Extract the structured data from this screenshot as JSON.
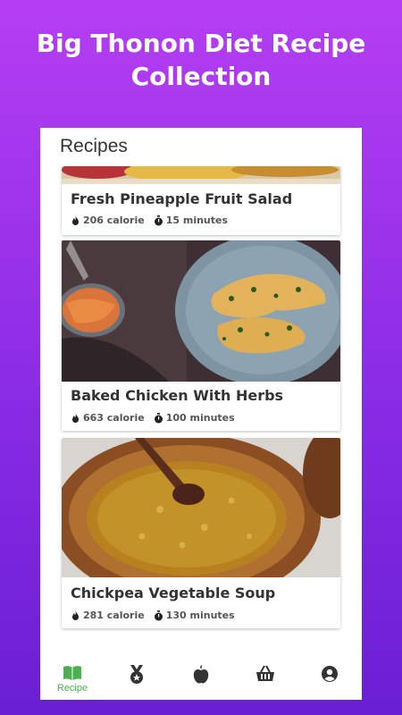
{
  "promo": {
    "headline_line1": "Big Thonon Diet Recipe",
    "headline_line2": "Collection"
  },
  "screen": {
    "section_title": "Recipes"
  },
  "recipes": [
    {
      "title": "Fresh Pineapple Fruit Salad",
      "calories": "206 calorie",
      "time": "15 minutes"
    },
    {
      "title": "Baked Chicken With Herbs",
      "calories": "663 calorie",
      "time": "100 minutes"
    },
    {
      "title": "Chickpea Vegetable Soup",
      "calories": "281 calorie",
      "time": "130 minutes"
    }
  ],
  "bottom_nav": [
    {
      "label": "Recipe",
      "icon": "book-icon",
      "active": true
    },
    {
      "label": "",
      "icon": "medal-icon",
      "active": false
    },
    {
      "label": "",
      "icon": "apple-icon",
      "active": false
    },
    {
      "label": "",
      "icon": "basket-icon",
      "active": false
    },
    {
      "label": "",
      "icon": "account-icon",
      "active": false
    }
  ],
  "colors": {
    "accent": "#4caf50",
    "gradient_top": "#b53ef2",
    "gradient_bottom": "#6a1fd4"
  }
}
